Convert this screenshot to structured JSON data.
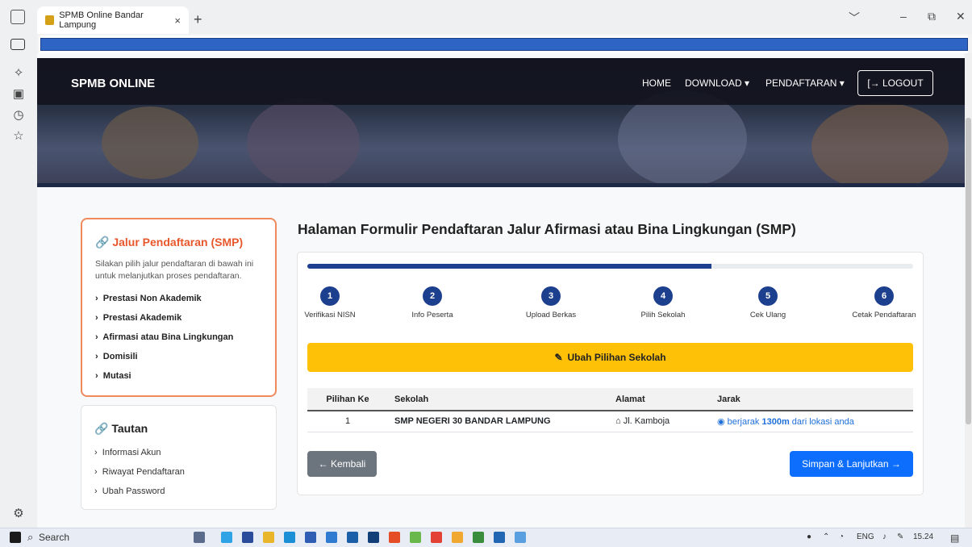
{
  "browser": {
    "tab_title": "SPMB Online Bandar Lampung",
    "tab_close": "×",
    "new_tab": "+",
    "window_controls": [
      "﹀",
      "–",
      "⧉",
      "✕"
    ]
  },
  "site": {
    "brand": "SPMB ONLINE",
    "nav": {
      "home": "HOME",
      "download": "DOWNLOAD ▾",
      "pendaftaran": "PENDAFTARAN ▾",
      "logout": "[→ LOGOUT"
    }
  },
  "left": {
    "jalur_title": "Jalur Pendaftaran (SMP)",
    "jalur_desc": "Silakan pilih jalur pendaftaran di bawah ini untuk melanjutkan proses pendaftaran.",
    "jalur_items": [
      "Prestasi Non Akademik",
      "Prestasi Akademik",
      "Afirmasi atau Bina Lingkungan",
      "Domisili",
      "Mutasi"
    ],
    "tautan_title": "Tautan",
    "tautan_items": [
      "Informasi Akun",
      "Riwayat Pendaftaran",
      "Ubah Password"
    ]
  },
  "main": {
    "title": "Halaman Formulir Pendaftaran Jalur Afirmasi atau Bina Lingkungan (SMP)",
    "progress": 0.667,
    "steps": [
      {
        "num": "1",
        "label": "Verifikasi NISN"
      },
      {
        "num": "2",
        "label": "Info Peserta"
      },
      {
        "num": "3",
        "label": "Upload Berkas"
      },
      {
        "num": "4",
        "label": "Pilih Sekolah"
      },
      {
        "num": "5",
        "label": "Cek Ulang"
      },
      {
        "num": "6",
        "label": "Cetak Pendaftaran"
      }
    ],
    "ubah_button": "Ubah Pilihan Sekolah",
    "table": {
      "headers": [
        "Pilihan Ke",
        "Sekolah",
        "Alamat",
        "Jarak"
      ],
      "row": {
        "pilihan": "1",
        "sekolah": "SMP NEGERI 30 BANDAR LAMPUNG",
        "alamat": "Jl. Kamboja",
        "jarak_prefix": "berjarak",
        "jarak_value": "1300m",
        "jarak_suffix": "dari lokasi anda"
      }
    },
    "back_button": "← Kembali",
    "next_button": "Simpan & Lanjutkan →"
  },
  "taskbar": {
    "search": "Search",
    "time": "15.24",
    "tray_lang": "ENG"
  },
  "colors": {
    "accent": "#1c3f8e",
    "orange": "#e8572b",
    "yellow": "#ffc107",
    "primary": "#0d6efd",
    "secondary": "#6c757d"
  }
}
